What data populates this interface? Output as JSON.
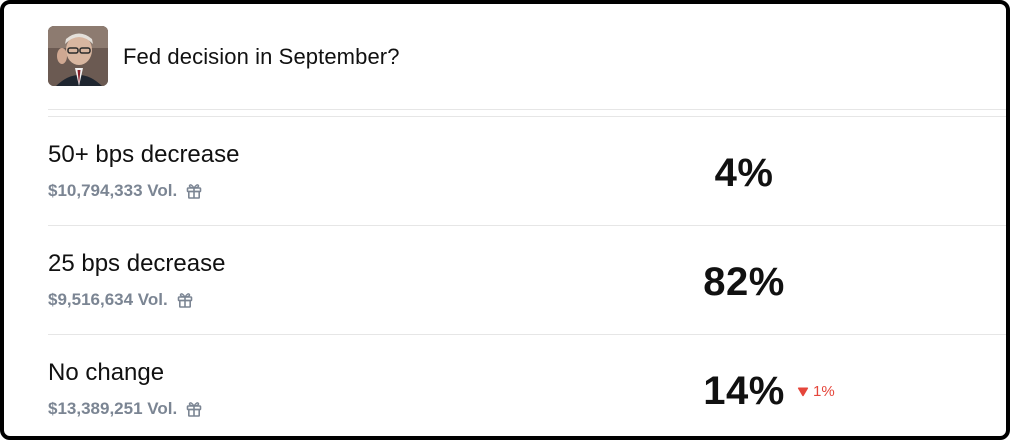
{
  "market": {
    "title": "Fed decision in September?",
    "avatar_alt": "Fed chair portrait"
  },
  "outcomes": [
    {
      "name": "50+ bps decrease",
      "volume": "$10,794,333 Vol.",
      "probability": "4%",
      "change": ""
    },
    {
      "name": "25 bps decrease",
      "volume": "$9,516,634 Vol.",
      "probability": "82%",
      "change": ""
    },
    {
      "name": "No change",
      "volume": "$13,389,251 Vol.",
      "probability": "14%",
      "change": "1%",
      "change_direction": "down"
    }
  ],
  "icons": {
    "reward": "gift-icon",
    "change": "down-triangle-icon"
  },
  "colors": {
    "negative": "#e5463b",
    "muted": "#7b8593",
    "border": "#000000"
  }
}
